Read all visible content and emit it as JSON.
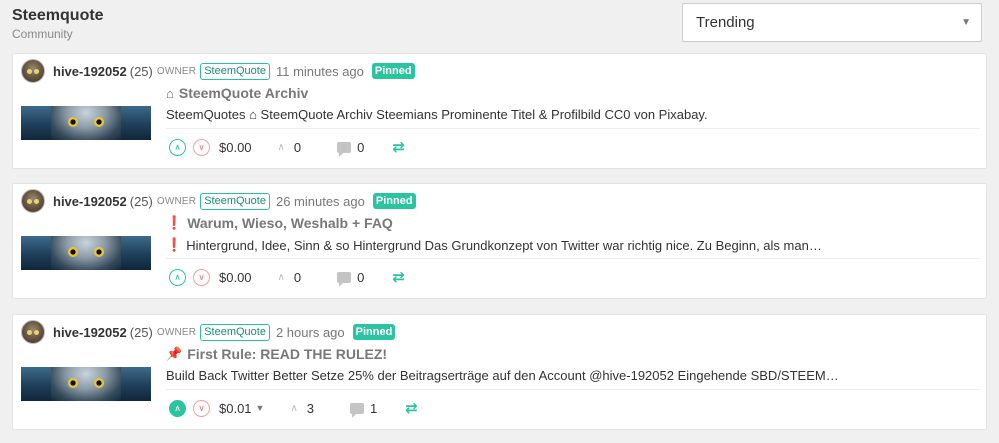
{
  "community": {
    "title": "Steemquote",
    "subtitle": "Community"
  },
  "sort": {
    "selected": "Trending"
  },
  "posts": [
    {
      "author": "hive-192052",
      "reputation": "(25)",
      "role": "OWNER",
      "tag": "SteemQuote",
      "time": "11 minutes ago",
      "badge": "Pinned",
      "title_icon": "▲",
      "title": "SteemQuote Archiv",
      "body": "SteemQuotes ⌂ SteemQuote Archiv Steemians Prominente Titel & Profilbild CC0 von Pixabay.",
      "payout": "$0.00",
      "votes": "0",
      "comments": "0"
    },
    {
      "author": "hive-192052",
      "reputation": "(25)",
      "role": "OWNER",
      "tag": "SteemQuote",
      "time": "26 minutes ago",
      "badge": "Pinned",
      "title_icon": "❗",
      "title": "Warum, Wieso, Weshalb + FAQ",
      "body_icon": "❗",
      "body": "Hintergrund, Idee, Sinn & so Hintergrund Das Grundkonzept von Twitter war richtig nice. Zu Beginn, als man…",
      "payout": "$0.00",
      "votes": "0",
      "comments": "0"
    },
    {
      "author": "hive-192052",
      "reputation": "(25)",
      "role": "OWNER",
      "tag": "SteemQuote",
      "time": "2 hours ago",
      "badge": "Pinned",
      "title_icon": "📌",
      "title": "First Rule: READ THE RULEZ!",
      "body": "Build Back Twitter Better Setze 25% der Beitragserträge auf den Account @hive-192052 Eingehende SBD/STEEM…",
      "payout": "$0.01",
      "votes": "3",
      "comments": "1"
    }
  ],
  "icons": {
    "upvote": "∧",
    "downvote": "∨",
    "vote_caret": "∧",
    "reblog": "⇄",
    "dropdown": "▼"
  },
  "colors": {
    "accent": "#2bc4a0",
    "downvote": "#e77777",
    "pinned": "#2bc4a0"
  }
}
